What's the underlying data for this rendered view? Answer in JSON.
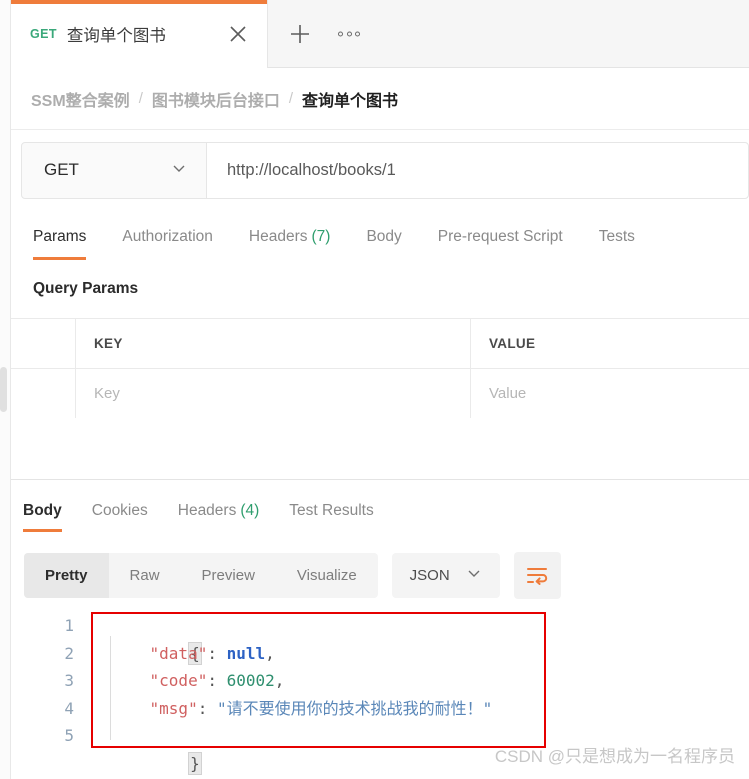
{
  "tab": {
    "method": "GET",
    "title": "查询单个图书",
    "close_icon": "close-icon",
    "new_tab_icon": "plus-icon",
    "more_icon": "more-horizontal-icon"
  },
  "breadcrumb": {
    "items": [
      "SSM整合案例",
      "图书模块后台接口",
      "查询单个图书"
    ],
    "separator": "/"
  },
  "request": {
    "method": "GET",
    "url": "http://localhost/books/1",
    "tabs": [
      {
        "label": "Params",
        "count": "",
        "active": true
      },
      {
        "label": "Authorization",
        "count": "",
        "active": false
      },
      {
        "label": "Headers",
        "count": "(7)",
        "active": false
      },
      {
        "label": "Body",
        "count": "",
        "active": false
      },
      {
        "label": "Pre-request Script",
        "count": "",
        "active": false
      },
      {
        "label": "Tests",
        "count": "",
        "active": false
      }
    ],
    "query_params": {
      "title": "Query Params",
      "headers": [
        "KEY",
        "VALUE"
      ],
      "rows": [
        {
          "key_placeholder": "Key",
          "value_placeholder": "Value"
        }
      ]
    }
  },
  "response": {
    "tabs": [
      {
        "label": "Body",
        "count": "",
        "active": true
      },
      {
        "label": "Cookies",
        "count": "",
        "active": false
      },
      {
        "label": "Headers",
        "count": "(4)",
        "active": false
      },
      {
        "label": "Test Results",
        "count": "",
        "active": false
      }
    ],
    "format_segments": [
      {
        "label": "Pretty",
        "active": true
      },
      {
        "label": "Raw",
        "active": false
      },
      {
        "label": "Preview",
        "active": false
      },
      {
        "label": "Visualize",
        "active": false
      }
    ],
    "language": "JSON",
    "wrap_icon": "wrap-text-icon",
    "body": {
      "line_numbers": [
        "1",
        "2",
        "3",
        "4",
        "5"
      ],
      "lines": [
        {
          "type": "brace_open",
          "text": "{"
        },
        {
          "type": "pair",
          "key": "\"data\"",
          "colon": ": ",
          "value": "null",
          "value_kind": "null",
          "comma": ","
        },
        {
          "type": "pair",
          "key": "\"code\"",
          "colon": ": ",
          "value": "60002",
          "value_kind": "number",
          "comma": ","
        },
        {
          "type": "pair",
          "key": "\"msg\"",
          "colon": ": ",
          "value": "\"请不要使用你的技术挑战我的耐性！\"",
          "value_kind": "string",
          "comma": ""
        },
        {
          "type": "brace_close",
          "text": "}"
        }
      ]
    }
  },
  "annotation": {
    "highlight_color": "#e60000"
  },
  "watermark": {
    "text": "CSDN @只是想成为一名程序员"
  },
  "colors": {
    "accent": "#ef7c3b",
    "method_get": "#3aa87a",
    "badge": "#2f9e6e"
  }
}
